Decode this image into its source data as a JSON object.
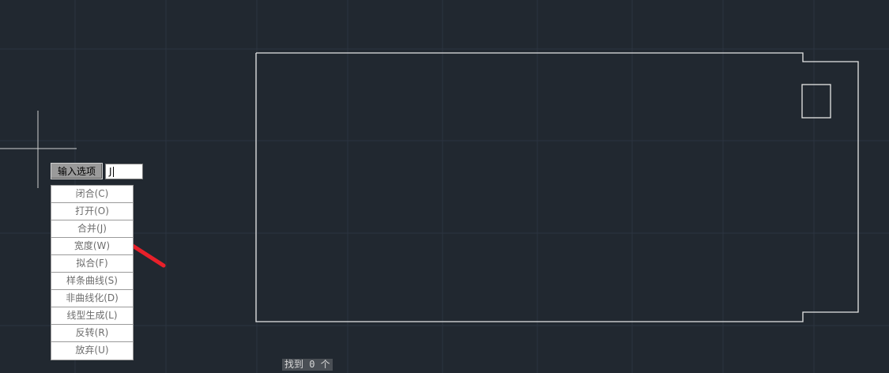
{
  "command_prompt": {
    "label": "输入选项",
    "input_value": "J"
  },
  "options_menu": [
    {
      "label": "闭合(C)"
    },
    {
      "label": "打开(O)"
    },
    {
      "label": "合并(J)"
    },
    {
      "label": "宽度(W)"
    },
    {
      "label": "拟合(F)"
    },
    {
      "label": "样条曲线(S)"
    },
    {
      "label": "非曲线化(D)"
    },
    {
      "label": "线型生成(L)"
    },
    {
      "label": "反转(R)"
    },
    {
      "label": "放弃(U)"
    }
  ],
  "status": {
    "text": "找到 0 个"
  },
  "colors": {
    "background": "#212830",
    "grid": "#2c3440",
    "geometry": "#e6e6e6",
    "annotation_arrow": "#e8202a",
    "crosshair": "#d0d0d0"
  },
  "icons": {
    "cursor": "crosshair-cursor-icon",
    "annotation": "red-arrow-annotation-icon"
  }
}
